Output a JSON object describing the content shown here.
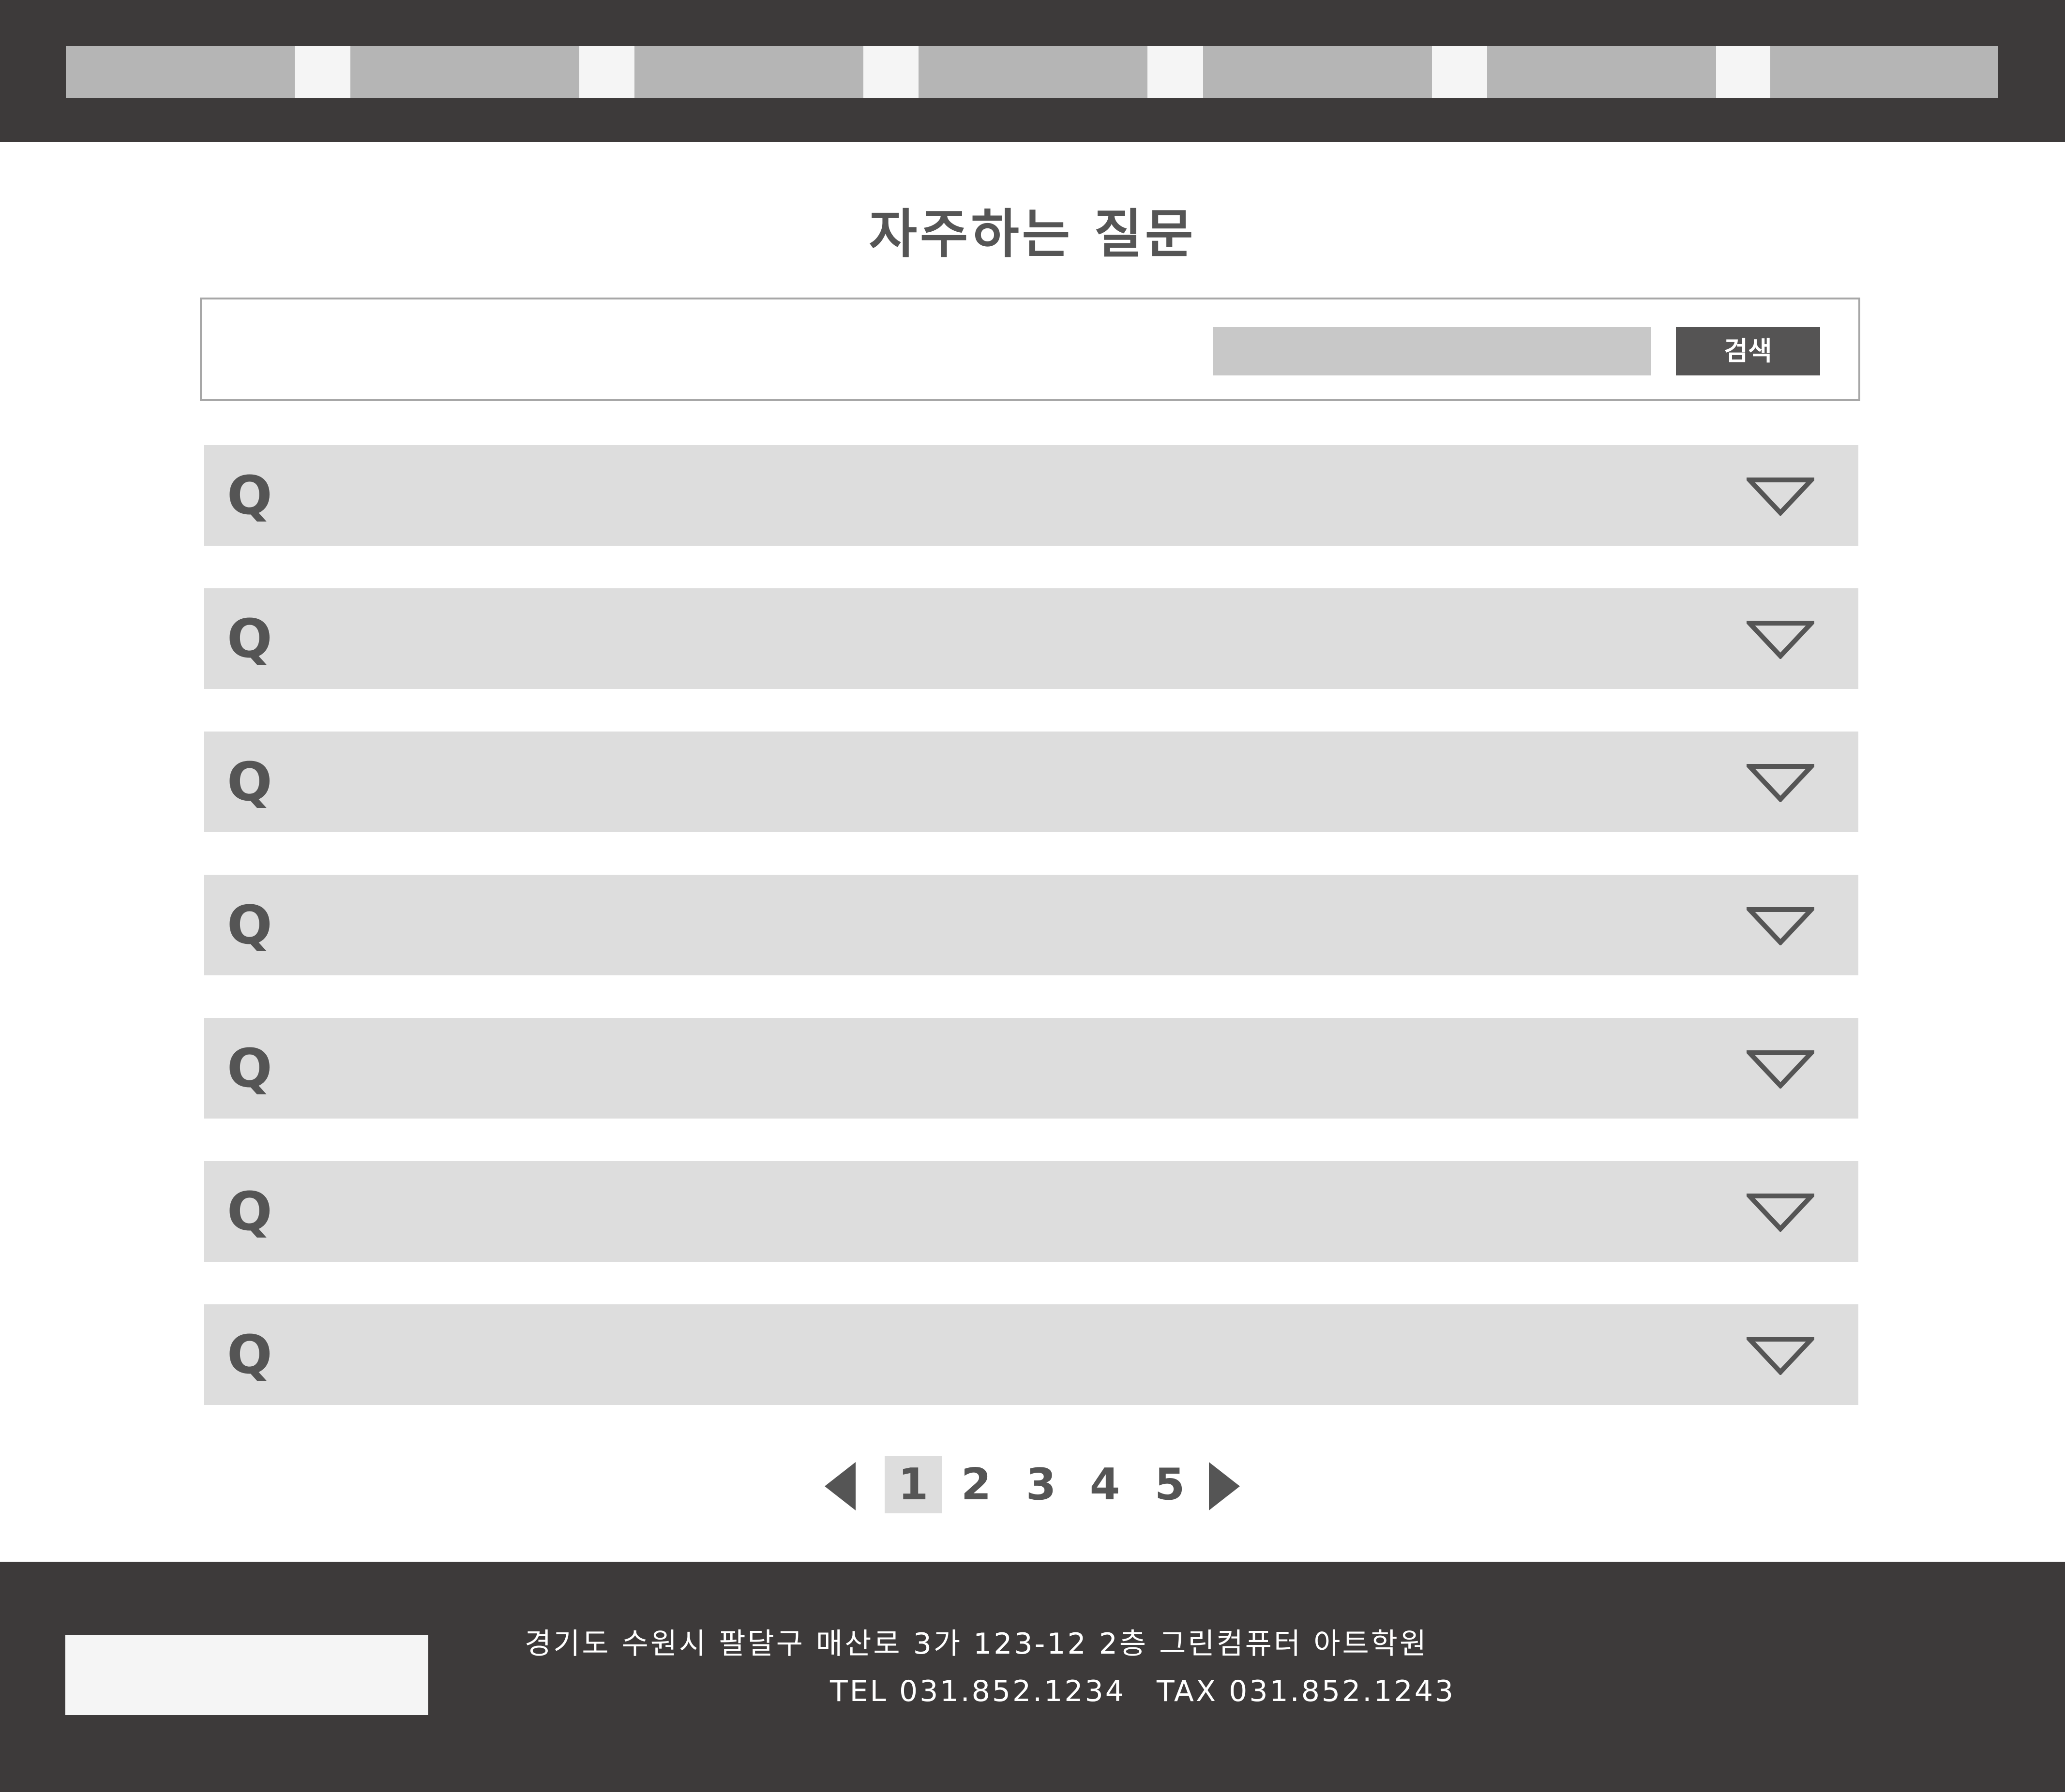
{
  "nav": {
    "item_count": 7
  },
  "page": {
    "title": "자주하는 질문"
  },
  "search": {
    "placeholder": "",
    "button_label": "검색"
  },
  "faq": {
    "items": [
      {
        "prefix": "Q"
      },
      {
        "prefix": "Q"
      },
      {
        "prefix": "Q"
      },
      {
        "prefix": "Q"
      },
      {
        "prefix": "Q"
      },
      {
        "prefix": "Q"
      },
      {
        "prefix": "Q"
      }
    ]
  },
  "pagination": {
    "pages": [
      "1",
      "2",
      "3",
      "4",
      "5"
    ],
    "current": "1"
  },
  "footer": {
    "address": "경기도 수원시 팔달구 매산로 3가 123-12 2층 그린컴퓨터 아트학원",
    "contact": "TEL 031.852.1234　TAX 031.852.1243"
  },
  "colors": {
    "header_bg": "#3d3a3a",
    "nav_item": "#b5b5b5",
    "faq_bg": "#dddddd",
    "text": "#555555",
    "button_bg": "#555454"
  },
  "icons": {
    "faq_toggle": "triangle-down-outline",
    "prev": "triangle-left-filled",
    "next": "triangle-right-filled"
  }
}
